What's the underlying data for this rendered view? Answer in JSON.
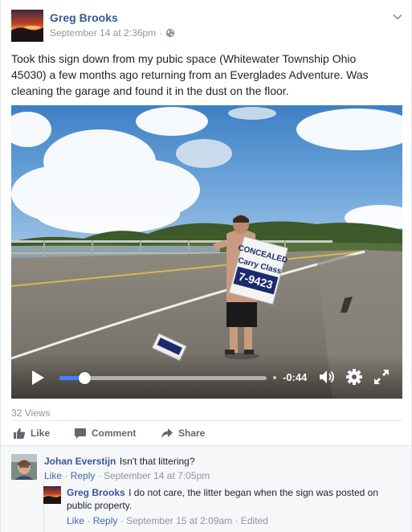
{
  "post": {
    "author": "Greg Brooks",
    "date": "September 14 at 2:36pm",
    "separator": "·",
    "privacy_icon": "globe-icon",
    "text": "Took this sign down from my pubic space (Whitewater Township Ohio 45030) a few months ago returning from an Everglades Adventure. Was cleaning the garage and found it in the dust on the floor."
  },
  "video": {
    "sign_text": [
      "CONCEALED",
      "Carry Class",
      "7-9423"
    ],
    "time_remaining": "-0:44",
    "progress": 0.12,
    "controls": [
      "play-icon",
      "volume-icon",
      "gear-icon",
      "fullscreen-icon"
    ]
  },
  "stats": {
    "views": "32 Views"
  },
  "actions": {
    "like": "Like",
    "comment": "Comment",
    "share": "Share"
  },
  "comments": [
    {
      "author": "Johan Everstijn",
      "text": "Isn't that littering?",
      "like": "Like",
      "reply": "Reply",
      "sep": "·",
      "time": "September 14 at 7:05pm"
    },
    {
      "author": "Greg Brooks",
      "text": "I do not care, the litter began when the sign was posted on public property.",
      "like": "Like",
      "reply": "Reply",
      "sep": "·",
      "time": "September 15 at 2:09am",
      "edited": "Edited"
    }
  ],
  "colors": {
    "link": "#365899",
    "meta": "#90949c",
    "progress": "#4080ff",
    "action": "#606770"
  }
}
